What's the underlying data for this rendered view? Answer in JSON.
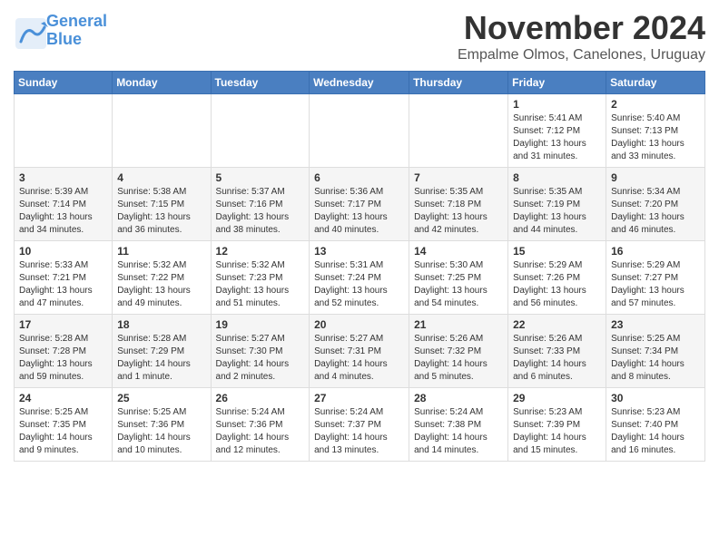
{
  "header": {
    "logo_line1": "General",
    "logo_line2": "Blue",
    "month_title": "November 2024",
    "location": "Empalme Olmos, Canelones, Uruguay"
  },
  "days_of_week": [
    "Sunday",
    "Monday",
    "Tuesday",
    "Wednesday",
    "Thursday",
    "Friday",
    "Saturday"
  ],
  "weeks": [
    [
      {
        "day": "",
        "info": ""
      },
      {
        "day": "",
        "info": ""
      },
      {
        "day": "",
        "info": ""
      },
      {
        "day": "",
        "info": ""
      },
      {
        "day": "",
        "info": ""
      },
      {
        "day": "1",
        "info": "Sunrise: 5:41 AM\nSunset: 7:12 PM\nDaylight: 13 hours and 31 minutes."
      },
      {
        "day": "2",
        "info": "Sunrise: 5:40 AM\nSunset: 7:13 PM\nDaylight: 13 hours and 33 minutes."
      }
    ],
    [
      {
        "day": "3",
        "info": "Sunrise: 5:39 AM\nSunset: 7:14 PM\nDaylight: 13 hours and 34 minutes."
      },
      {
        "day": "4",
        "info": "Sunrise: 5:38 AM\nSunset: 7:15 PM\nDaylight: 13 hours and 36 minutes."
      },
      {
        "day": "5",
        "info": "Sunrise: 5:37 AM\nSunset: 7:16 PM\nDaylight: 13 hours and 38 minutes."
      },
      {
        "day": "6",
        "info": "Sunrise: 5:36 AM\nSunset: 7:17 PM\nDaylight: 13 hours and 40 minutes."
      },
      {
        "day": "7",
        "info": "Sunrise: 5:35 AM\nSunset: 7:18 PM\nDaylight: 13 hours and 42 minutes."
      },
      {
        "day": "8",
        "info": "Sunrise: 5:35 AM\nSunset: 7:19 PM\nDaylight: 13 hours and 44 minutes."
      },
      {
        "day": "9",
        "info": "Sunrise: 5:34 AM\nSunset: 7:20 PM\nDaylight: 13 hours and 46 minutes."
      }
    ],
    [
      {
        "day": "10",
        "info": "Sunrise: 5:33 AM\nSunset: 7:21 PM\nDaylight: 13 hours and 47 minutes."
      },
      {
        "day": "11",
        "info": "Sunrise: 5:32 AM\nSunset: 7:22 PM\nDaylight: 13 hours and 49 minutes."
      },
      {
        "day": "12",
        "info": "Sunrise: 5:32 AM\nSunset: 7:23 PM\nDaylight: 13 hours and 51 minutes."
      },
      {
        "day": "13",
        "info": "Sunrise: 5:31 AM\nSunset: 7:24 PM\nDaylight: 13 hours and 52 minutes."
      },
      {
        "day": "14",
        "info": "Sunrise: 5:30 AM\nSunset: 7:25 PM\nDaylight: 13 hours and 54 minutes."
      },
      {
        "day": "15",
        "info": "Sunrise: 5:29 AM\nSunset: 7:26 PM\nDaylight: 13 hours and 56 minutes."
      },
      {
        "day": "16",
        "info": "Sunrise: 5:29 AM\nSunset: 7:27 PM\nDaylight: 13 hours and 57 minutes."
      }
    ],
    [
      {
        "day": "17",
        "info": "Sunrise: 5:28 AM\nSunset: 7:28 PM\nDaylight: 13 hours and 59 minutes."
      },
      {
        "day": "18",
        "info": "Sunrise: 5:28 AM\nSunset: 7:29 PM\nDaylight: 14 hours and 1 minute."
      },
      {
        "day": "19",
        "info": "Sunrise: 5:27 AM\nSunset: 7:30 PM\nDaylight: 14 hours and 2 minutes."
      },
      {
        "day": "20",
        "info": "Sunrise: 5:27 AM\nSunset: 7:31 PM\nDaylight: 14 hours and 4 minutes."
      },
      {
        "day": "21",
        "info": "Sunrise: 5:26 AM\nSunset: 7:32 PM\nDaylight: 14 hours and 5 minutes."
      },
      {
        "day": "22",
        "info": "Sunrise: 5:26 AM\nSunset: 7:33 PM\nDaylight: 14 hours and 6 minutes."
      },
      {
        "day": "23",
        "info": "Sunrise: 5:25 AM\nSunset: 7:34 PM\nDaylight: 14 hours and 8 minutes."
      }
    ],
    [
      {
        "day": "24",
        "info": "Sunrise: 5:25 AM\nSunset: 7:35 PM\nDaylight: 14 hours and 9 minutes."
      },
      {
        "day": "25",
        "info": "Sunrise: 5:25 AM\nSunset: 7:36 PM\nDaylight: 14 hours and 10 minutes."
      },
      {
        "day": "26",
        "info": "Sunrise: 5:24 AM\nSunset: 7:36 PM\nDaylight: 14 hours and 12 minutes."
      },
      {
        "day": "27",
        "info": "Sunrise: 5:24 AM\nSunset: 7:37 PM\nDaylight: 14 hours and 13 minutes."
      },
      {
        "day": "28",
        "info": "Sunrise: 5:24 AM\nSunset: 7:38 PM\nDaylight: 14 hours and 14 minutes."
      },
      {
        "day": "29",
        "info": "Sunrise: 5:23 AM\nSunset: 7:39 PM\nDaylight: 14 hours and 15 minutes."
      },
      {
        "day": "30",
        "info": "Sunrise: 5:23 AM\nSunset: 7:40 PM\nDaylight: 14 hours and 16 minutes."
      }
    ]
  ]
}
